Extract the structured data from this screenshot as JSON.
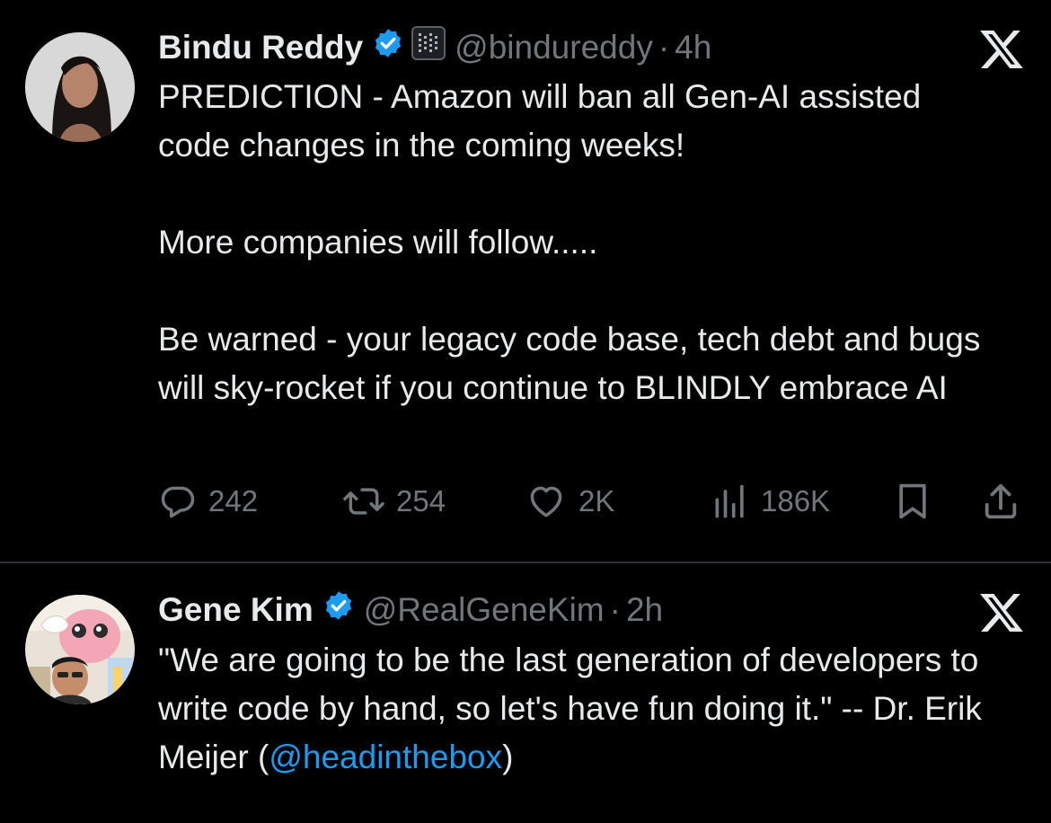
{
  "tweets": [
    {
      "author": "Bindu Reddy",
      "handle": "@bindureddy",
      "separator": "·",
      "time": "4h",
      "paragraphs": [
        "PREDICTION - Amazon will ban all Gen-AI assisted code changes in the coming weeks!",
        "More companies will follow.....",
        "Be warned - your legacy code base, tech debt and bugs will sky-rocket if you continue to BLINDLY embrace AI"
      ],
      "metrics": {
        "replies": "242",
        "reposts": "254",
        "likes": "2K",
        "views": "186K"
      }
    },
    {
      "author": "Gene Kim",
      "handle": "@RealGeneKim",
      "separator": "·",
      "time": "2h",
      "text_before": "\"We are going to be the last generation of developers to write code by hand, so let's have fun doing it.\" -- Dr. Erik Meijer (",
      "mention": "@headinthebox",
      "text_after": ")"
    }
  ],
  "colors": {
    "background": "#000000",
    "text": "#e7e9ea",
    "muted": "#71767b",
    "accent": "#1d9bf0",
    "divider": "#2f3336"
  },
  "icons": [
    "verified-badge-icon",
    "org-badge-icon",
    "x-logo-icon",
    "reply-icon",
    "repost-icon",
    "like-icon",
    "views-icon",
    "bookmark-icon",
    "share-icon"
  ]
}
